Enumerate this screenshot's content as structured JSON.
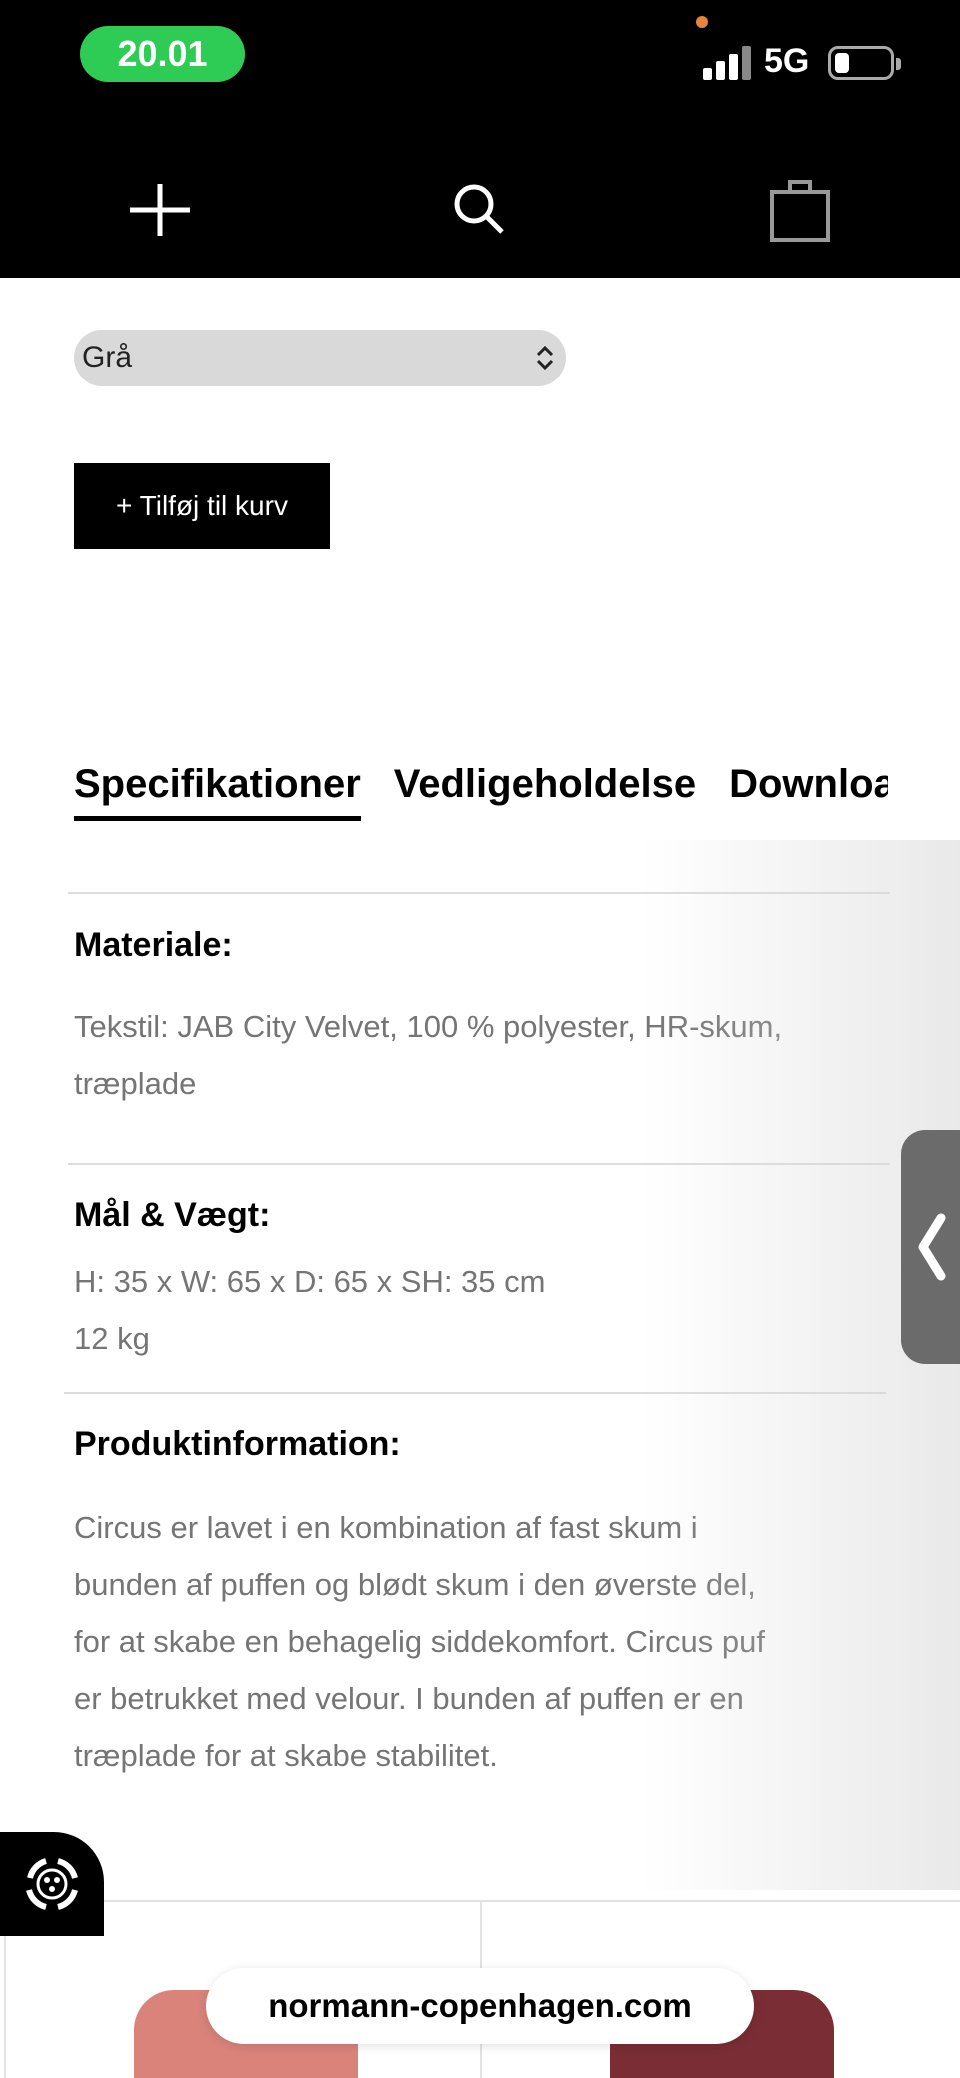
{
  "status_bar": {
    "time": "20.01",
    "network": "5G"
  },
  "nav": {
    "icons": [
      "menu-icon",
      "search-icon",
      "shopping-bag-icon"
    ]
  },
  "product": {
    "color_select": "Grå",
    "add_to_cart": "+ Tilføj til kurv"
  },
  "tabs": [
    {
      "label": "Specifikationer",
      "active": true
    },
    {
      "label": "Vedligeholdelse",
      "active": false
    },
    {
      "label": "Downloads",
      "active": false
    }
  ],
  "specs": {
    "material_title": "Materiale:",
    "material_line1": "Tekstil: JAB City Velvet, 100 % polyester, HR-skum,",
    "material_line2": "træplade",
    "dimensions_title": "Mål & Vægt:",
    "dimensions_line1": "H: 35 x W: 65 x D: 65 x SH: 35 cm",
    "dimensions_line2": "12 kg",
    "info_title": "Produktinformation:",
    "info_lines": [
      "Circus er lavet i en kombination af fast skum i",
      "bunden af puffen og blødt skum i den øverste del,",
      "for at skabe en behagelig siddekomfort. Circus puf",
      "er betrukket med velour. I bunden af puffen er en",
      "træplade for at skabe stabilitet."
    ]
  },
  "browser": {
    "url": "normann-copenhagen.com"
  },
  "colors": {
    "time_pill": "#2ecc55",
    "button_bg": "#000000",
    "secondary_text": "#757575",
    "select_bg": "#d9d9d9"
  }
}
